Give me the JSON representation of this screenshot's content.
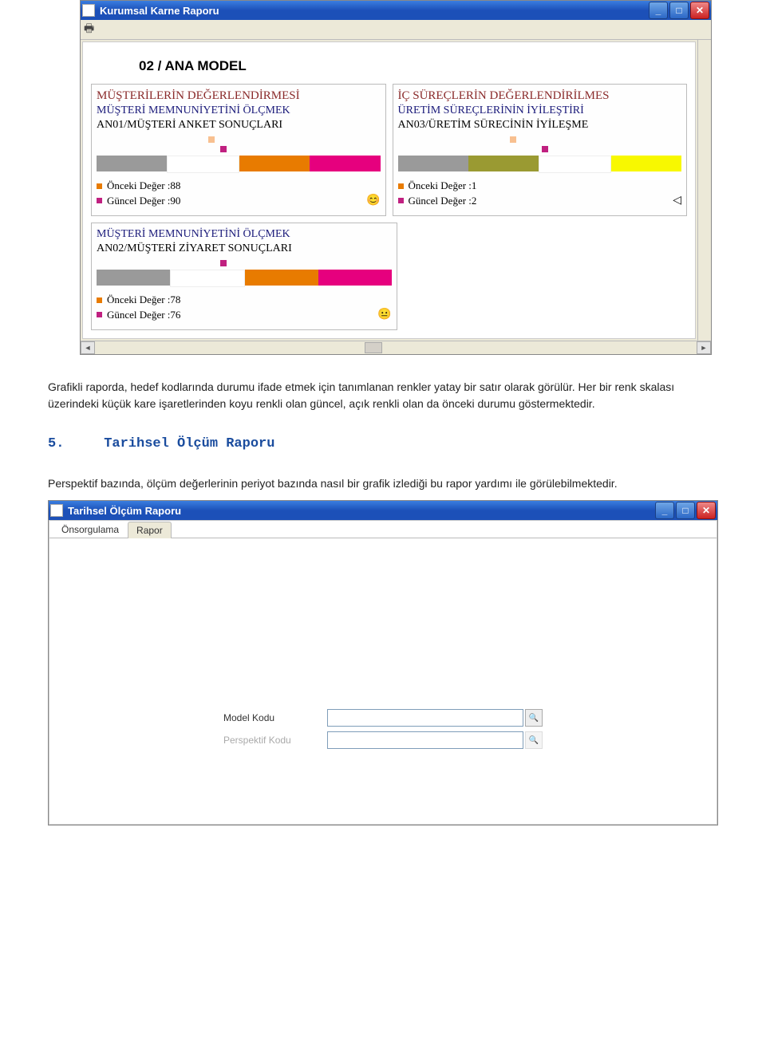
{
  "window1": {
    "title": "Kurumsal Karne Raporu",
    "report_title": "02 / ANA MODEL",
    "cards": {
      "c1": {
        "h1": "MÜŞTERİLERİN DEĞERLENDİRMESİ",
        "h2": "MÜŞTERİ MEMNUNİYETİNİ ÖLÇMEK",
        "h3": "AN01/MÜŞTERİ ANKET SONUÇLARI",
        "prev_label": "Önceki Değer :88",
        "curr_label": "Güncel Değer :90",
        "emoji": "😊"
      },
      "c2": {
        "h1": "İÇ SÜREÇLERİN DEĞERLENDİRİLMES",
        "h2": "ÜRETİM SÜREÇLERİNİN İYİLEŞTİRİ",
        "h3": "AN03/ÜRETİM SÜRECİNİN İYİLEŞME",
        "prev_label": "Önceki Değer :1",
        "curr_label": "Güncel Değer :2",
        "emoji": "◁"
      },
      "c3": {
        "h2": "MÜŞTERİ MEMNUNİYETİNİ ÖLÇMEK",
        "h3": "AN02/MÜŞTERİ ZİYARET SONUÇLARI",
        "prev_label": "Önceki Değer :78",
        "curr_label": "Güncel Değer :76",
        "emoji": "😐"
      }
    }
  },
  "doc": {
    "p1": "Grafikli raporda, hedef kodlarında durumu ifade etmek için tanımlanan renkler yatay bir satır olarak görülür. Her bir renk skalası üzerindeki küçük kare işaretlerinden koyu renkli olan güncel, açık renkli olan da önceki durumu göstermektedir.",
    "section_num": "5.",
    "section_title": "Tarihsel Ölçüm Raporu",
    "p2": "Perspektif bazında, ölçüm değerlerinin periyot bazında nasıl bir grafik izlediği bu rapor yardımı ile görülebilmektedir."
  },
  "window2": {
    "title": "Tarihsel Ölçüm Raporu",
    "tab1": "Önsorgulama",
    "tab2": "Rapor",
    "field1_label": "Model Kodu",
    "field2_label": "Perspektif Kodu"
  },
  "colors": {
    "bar_gray": "#9a9a9a",
    "bar_white": "#ffffff",
    "bar_orange": "#e87b00",
    "bar_pink": "#e6007e",
    "bar_olive": "#9a9a32",
    "bar_yellow": "#f8f800",
    "sw_prev": "#e87b00",
    "sw_curr": "#c02080"
  },
  "chart_data": [
    {
      "type": "bar",
      "title": "AN01/MÜŞTERİ ANKET SONUÇLARI",
      "series": [
        {
          "name": "Önceki Değer",
          "values": [
            88
          ]
        },
        {
          "name": "Güncel Değer",
          "values": [
            90
          ]
        }
      ],
      "scale_colors": [
        "gray",
        "white",
        "orange",
        "pink"
      ]
    },
    {
      "type": "bar",
      "title": "AN03/ÜRETİM SÜRECİNİN İYİLEŞME",
      "series": [
        {
          "name": "Önceki Değer",
          "values": [
            1
          ]
        },
        {
          "name": "Güncel Değer",
          "values": [
            2
          ]
        }
      ],
      "scale_colors": [
        "gray",
        "olive",
        "white",
        "yellow"
      ]
    },
    {
      "type": "bar",
      "title": "AN02/MÜŞTERİ ZİYARET SONUÇLARI",
      "series": [
        {
          "name": "Önceki Değer",
          "values": [
            78
          ]
        },
        {
          "name": "Güncel Değer",
          "values": [
            76
          ]
        }
      ],
      "scale_colors": [
        "gray",
        "white",
        "orange",
        "pink"
      ]
    }
  ]
}
